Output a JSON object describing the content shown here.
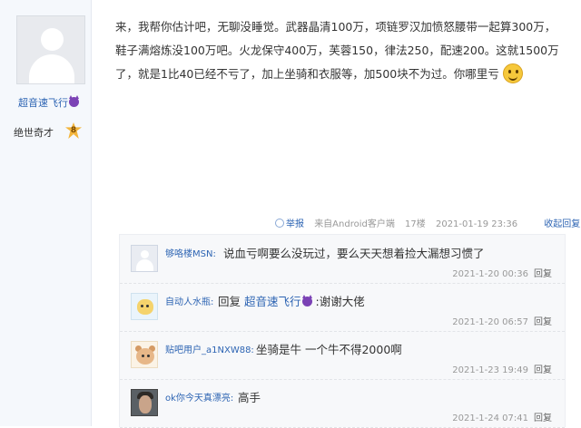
{
  "author": {
    "name": "超音速飞行",
    "title": "绝世奇才",
    "level": "8",
    "badge_icon": "devil-icon"
  },
  "post": {
    "content": "来，我帮你估计吧，无聊没睡觉。武器晶清100万，项链罗汉加愤怒腰带一起算300万，鞋子满熔炼没100万吧。火龙保守400万，芙蓉150，律法250，配速200。这就1500万了，就是1比40已经不亏了，加上坐骑和衣服等，加500块不为过。你哪里亏",
    "emoji": "smiley-icon"
  },
  "meta": {
    "report": "举报",
    "source": "来自Android客户端",
    "floor": "17楼",
    "time": "2021-01-19 23:36",
    "collapse": "收起回复"
  },
  "replies": [
    {
      "name": "够咯楼MSN:",
      "text": "说血亏啊要么没玩过，要么天天想着捡大漏想习惯了",
      "time": "2021-1-20 00:36",
      "reply_label": "回复"
    },
    {
      "name": "自动人水瓶:",
      "text_prefix": "回复",
      "mention": "超音速飞行",
      "text_suffix": ":谢谢大佬",
      "time": "2021-1-20 06:57",
      "reply_label": "回复"
    },
    {
      "name": "贴吧用户_a1NXW88:",
      "text": "坐骑是牛 一个牛不得2000啊",
      "time": "2021-1-23 19:49",
      "reply_label": "回复"
    },
    {
      "name": "ok你今天真漂亮:",
      "text": "高手",
      "time": "2021-1-24 07:41",
      "reply_label": "回复"
    }
  ],
  "colors": {
    "link": "#2d64b3",
    "sidebar_bg": "#f5f8fc",
    "reply_bg": "#f7f8fa"
  }
}
